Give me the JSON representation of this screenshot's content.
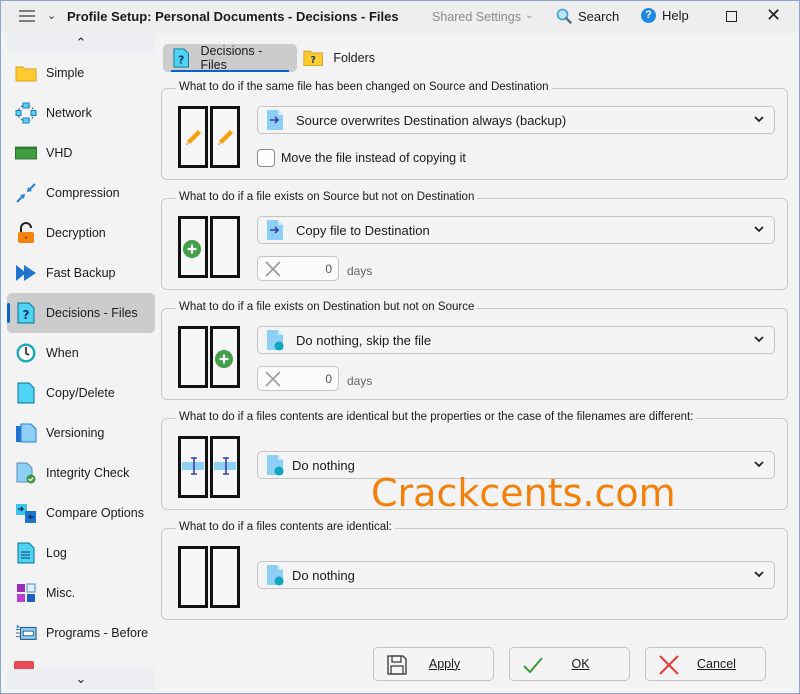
{
  "titlebar": {
    "title": "Profile Setup: Personal Documents - Decisions - Files",
    "shared_settings": "Shared Settings",
    "search": "Search",
    "help": "Help"
  },
  "sidebar": {
    "items": [
      {
        "label": "Simple",
        "icon": "folder-icon"
      },
      {
        "label": "Network",
        "icon": "network-icon"
      },
      {
        "label": "VHD",
        "icon": "vhd-drive-icon"
      },
      {
        "label": "Compression",
        "icon": "compress-arrows-icon"
      },
      {
        "label": "Decryption",
        "icon": "unlocked-padlock-icon"
      },
      {
        "label": "Fast Backup",
        "icon": "fast-forward-icon"
      },
      {
        "label": "Decisions - Files",
        "icon": "file-question-icon",
        "active": true
      },
      {
        "label": "When",
        "icon": "clock-icon"
      },
      {
        "label": "Copy/Delete",
        "icon": "document-icon"
      },
      {
        "label": "Versioning",
        "icon": "stacked-documents-icon"
      },
      {
        "label": "Integrity Check",
        "icon": "document-check-icon"
      },
      {
        "label": "Compare Options",
        "icon": "compare-documents-icon"
      },
      {
        "label": "Log",
        "icon": "log-document-icon"
      },
      {
        "label": "Misc.",
        "icon": "misc-tiles-icon"
      },
      {
        "label": "Programs - Before",
        "icon": "program-window-icon"
      }
    ]
  },
  "tabs": [
    {
      "label": "Decisions - Files",
      "active": true
    },
    {
      "label": "Folders",
      "active": false
    }
  ],
  "groups": [
    {
      "legend": "What to do if the same file has been changed on Source and Destination",
      "selected": "Source overwrites Destination always (backup)",
      "checkbox_label": "Move the file instead of copying it",
      "checkbox_checked": false
    },
    {
      "legend": "What to do if a file exists on Source but not on Destination",
      "selected": "Copy file to Destination",
      "days_value": "0",
      "days_label": "days"
    },
    {
      "legend": "What to do if a file exists on Destination but not on Source",
      "selected": "Do nothing, skip the file",
      "days_value": "0",
      "days_label": "days"
    },
    {
      "legend": "What to do if a files contents are identical but the properties or the case of the filenames are different:",
      "selected": "Do nothing"
    },
    {
      "legend": "What to do if a files contents are identical:",
      "selected": "Do nothing"
    }
  ],
  "watermark": "Crackcents.com",
  "buttons": {
    "apply": "Apply",
    "ok": "OK",
    "cancel": "Cancel"
  },
  "colors": {
    "accent": "#0a64c6",
    "watermark": "#f2800a",
    "ok_check": "#3a9a3a",
    "cancel_x": "#e53935",
    "add_green": "#43a047"
  }
}
